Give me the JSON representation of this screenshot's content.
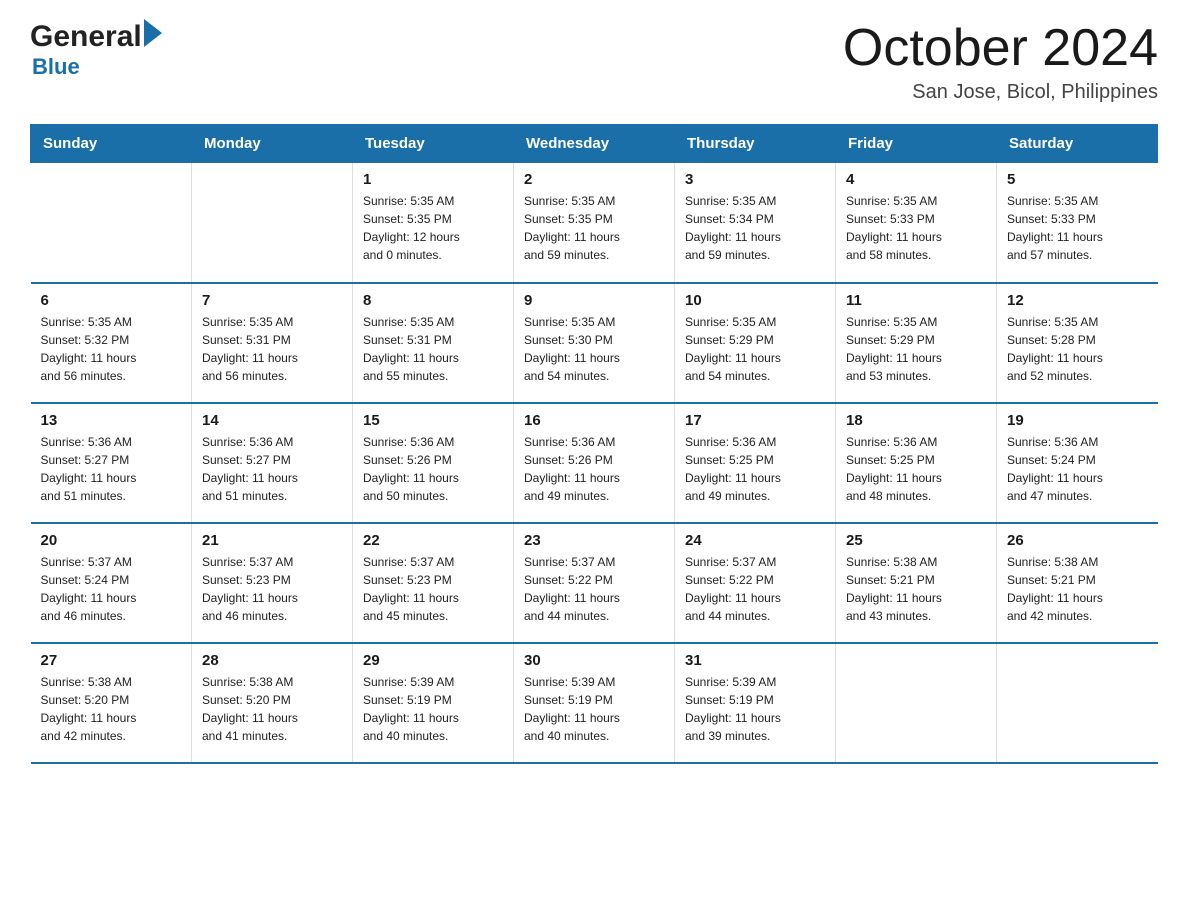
{
  "logo": {
    "text_general": "General",
    "text_blue": "Blue"
  },
  "header": {
    "month_year": "October 2024",
    "location": "San Jose, Bicol, Philippines"
  },
  "columns": [
    "Sunday",
    "Monday",
    "Tuesday",
    "Wednesday",
    "Thursday",
    "Friday",
    "Saturday"
  ],
  "weeks": [
    [
      {
        "day": "",
        "info": ""
      },
      {
        "day": "",
        "info": ""
      },
      {
        "day": "1",
        "info": "Sunrise: 5:35 AM\nSunset: 5:35 PM\nDaylight: 12 hours\nand 0 minutes."
      },
      {
        "day": "2",
        "info": "Sunrise: 5:35 AM\nSunset: 5:35 PM\nDaylight: 11 hours\nand 59 minutes."
      },
      {
        "day": "3",
        "info": "Sunrise: 5:35 AM\nSunset: 5:34 PM\nDaylight: 11 hours\nand 59 minutes."
      },
      {
        "day": "4",
        "info": "Sunrise: 5:35 AM\nSunset: 5:33 PM\nDaylight: 11 hours\nand 58 minutes."
      },
      {
        "day": "5",
        "info": "Sunrise: 5:35 AM\nSunset: 5:33 PM\nDaylight: 11 hours\nand 57 minutes."
      }
    ],
    [
      {
        "day": "6",
        "info": "Sunrise: 5:35 AM\nSunset: 5:32 PM\nDaylight: 11 hours\nand 56 minutes."
      },
      {
        "day": "7",
        "info": "Sunrise: 5:35 AM\nSunset: 5:31 PM\nDaylight: 11 hours\nand 56 minutes."
      },
      {
        "day": "8",
        "info": "Sunrise: 5:35 AM\nSunset: 5:31 PM\nDaylight: 11 hours\nand 55 minutes."
      },
      {
        "day": "9",
        "info": "Sunrise: 5:35 AM\nSunset: 5:30 PM\nDaylight: 11 hours\nand 54 minutes."
      },
      {
        "day": "10",
        "info": "Sunrise: 5:35 AM\nSunset: 5:29 PM\nDaylight: 11 hours\nand 54 minutes."
      },
      {
        "day": "11",
        "info": "Sunrise: 5:35 AM\nSunset: 5:29 PM\nDaylight: 11 hours\nand 53 minutes."
      },
      {
        "day": "12",
        "info": "Sunrise: 5:35 AM\nSunset: 5:28 PM\nDaylight: 11 hours\nand 52 minutes."
      }
    ],
    [
      {
        "day": "13",
        "info": "Sunrise: 5:36 AM\nSunset: 5:27 PM\nDaylight: 11 hours\nand 51 minutes."
      },
      {
        "day": "14",
        "info": "Sunrise: 5:36 AM\nSunset: 5:27 PM\nDaylight: 11 hours\nand 51 minutes."
      },
      {
        "day": "15",
        "info": "Sunrise: 5:36 AM\nSunset: 5:26 PM\nDaylight: 11 hours\nand 50 minutes."
      },
      {
        "day": "16",
        "info": "Sunrise: 5:36 AM\nSunset: 5:26 PM\nDaylight: 11 hours\nand 49 minutes."
      },
      {
        "day": "17",
        "info": "Sunrise: 5:36 AM\nSunset: 5:25 PM\nDaylight: 11 hours\nand 49 minutes."
      },
      {
        "day": "18",
        "info": "Sunrise: 5:36 AM\nSunset: 5:25 PM\nDaylight: 11 hours\nand 48 minutes."
      },
      {
        "day": "19",
        "info": "Sunrise: 5:36 AM\nSunset: 5:24 PM\nDaylight: 11 hours\nand 47 minutes."
      }
    ],
    [
      {
        "day": "20",
        "info": "Sunrise: 5:37 AM\nSunset: 5:24 PM\nDaylight: 11 hours\nand 46 minutes."
      },
      {
        "day": "21",
        "info": "Sunrise: 5:37 AM\nSunset: 5:23 PM\nDaylight: 11 hours\nand 46 minutes."
      },
      {
        "day": "22",
        "info": "Sunrise: 5:37 AM\nSunset: 5:23 PM\nDaylight: 11 hours\nand 45 minutes."
      },
      {
        "day": "23",
        "info": "Sunrise: 5:37 AM\nSunset: 5:22 PM\nDaylight: 11 hours\nand 44 minutes."
      },
      {
        "day": "24",
        "info": "Sunrise: 5:37 AM\nSunset: 5:22 PM\nDaylight: 11 hours\nand 44 minutes."
      },
      {
        "day": "25",
        "info": "Sunrise: 5:38 AM\nSunset: 5:21 PM\nDaylight: 11 hours\nand 43 minutes."
      },
      {
        "day": "26",
        "info": "Sunrise: 5:38 AM\nSunset: 5:21 PM\nDaylight: 11 hours\nand 42 minutes."
      }
    ],
    [
      {
        "day": "27",
        "info": "Sunrise: 5:38 AM\nSunset: 5:20 PM\nDaylight: 11 hours\nand 42 minutes."
      },
      {
        "day": "28",
        "info": "Sunrise: 5:38 AM\nSunset: 5:20 PM\nDaylight: 11 hours\nand 41 minutes."
      },
      {
        "day": "29",
        "info": "Sunrise: 5:39 AM\nSunset: 5:19 PM\nDaylight: 11 hours\nand 40 minutes."
      },
      {
        "day": "30",
        "info": "Sunrise: 5:39 AM\nSunset: 5:19 PM\nDaylight: 11 hours\nand 40 minutes."
      },
      {
        "day": "31",
        "info": "Sunrise: 5:39 AM\nSunset: 5:19 PM\nDaylight: 11 hours\nand 39 minutes."
      },
      {
        "day": "",
        "info": ""
      },
      {
        "day": "",
        "info": ""
      }
    ]
  ]
}
